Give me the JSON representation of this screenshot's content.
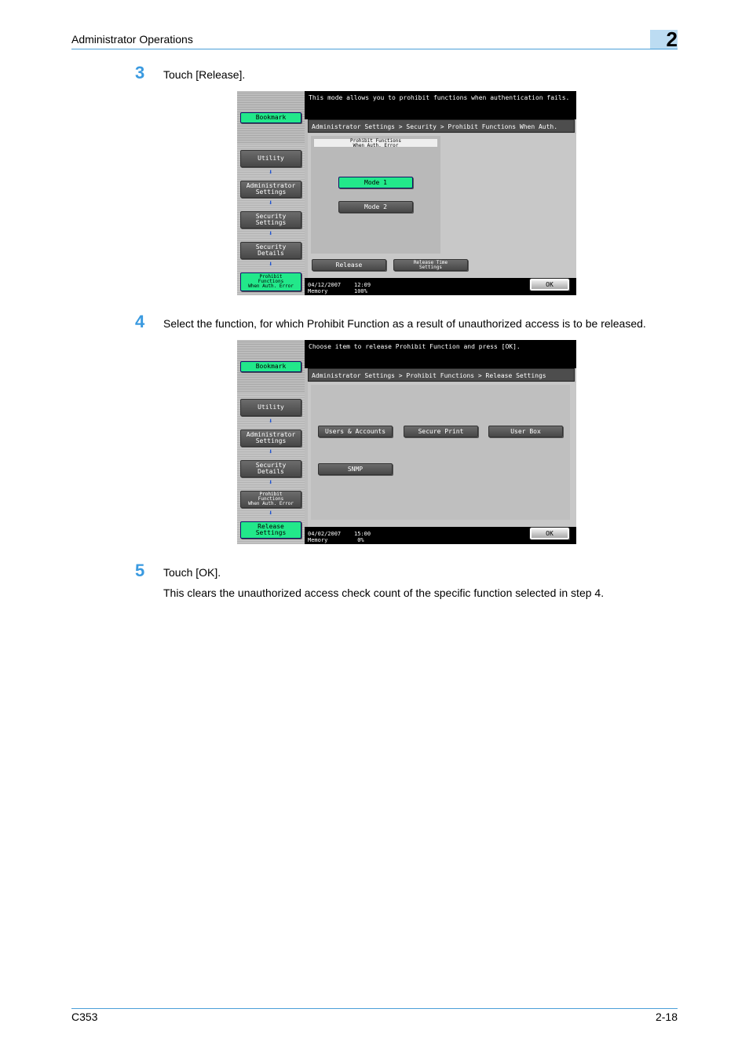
{
  "header": {
    "title": "Administrator Operations",
    "chapter": "2"
  },
  "steps": [
    {
      "num": "3",
      "text": "Touch [Release]."
    },
    {
      "num": "4",
      "text": "Select the function, for which Prohibit Function as a result of unauthorized access is to be released."
    },
    {
      "num": "5",
      "text": "Touch [OK].",
      "note": "This clears the unauthorized access check count of the specific function selected in step 4."
    }
  ],
  "screen1": {
    "message": "This mode allows you to prohibit functions when authentication fails.",
    "path": "Administrator Settings > Security > Prohibit Functions When Auth. Error",
    "panel_title": "Prohibit Functions\nWhen Auth. Error",
    "sidebar": {
      "bookmark": "Bookmark",
      "items": [
        "Utility",
        "Administrator\nSettings",
        "Security\nSettings",
        "Security Details",
        "Prohibit\nFunctions\nWhen Auth. Error"
      ]
    },
    "mode1": "Mode 1",
    "mode2": "Mode 2",
    "release": "Release",
    "release_time": "Release Time\nSettings",
    "datetime": "04/12/2007    12:09\nMemory        100%",
    "ok": "OK"
  },
  "screen2": {
    "message": "Choose item to release Prohibit Function and press [OK].",
    "path": "Administrator Settings > Prohibit Functions  > Release Settings",
    "sidebar": {
      "bookmark": "Bookmark",
      "items": [
        "Utility",
        "Administrator\nSettings",
        "Security Details",
        "Prohibit\nFunctions\nWhen Auth. Error",
        "Release Settings"
      ]
    },
    "buttons": [
      "Users & Accounts",
      "Secure Print",
      "User Box",
      "SNMP"
    ],
    "datetime": "04/02/2007    15:00\nMemory         0%",
    "ok": "OK"
  },
  "footer": {
    "model": "C353",
    "page": "2-18"
  }
}
